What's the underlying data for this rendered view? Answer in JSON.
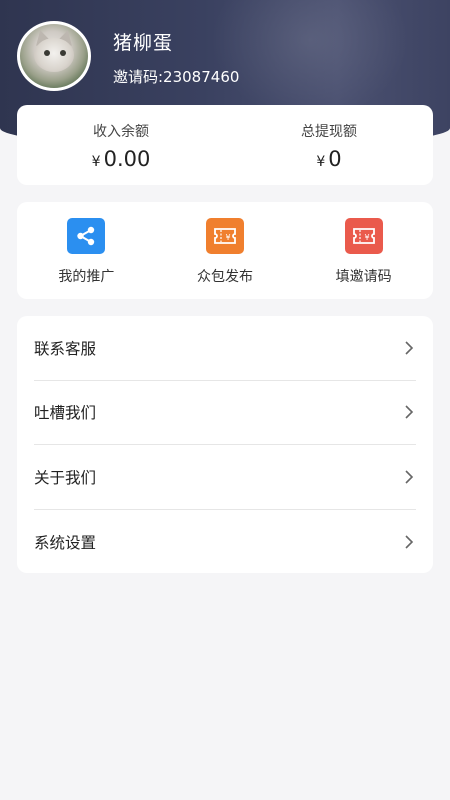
{
  "profile": {
    "username": "猪柳蛋",
    "invite_code": "邀请码:23087460"
  },
  "balance": {
    "income_label": "收入余额",
    "income_currency": "¥",
    "income_value": "0.00",
    "withdrawn_label": "总提现额",
    "withdrawn_currency": "¥",
    "withdrawn_value": "0"
  },
  "actions": [
    {
      "label": "我的推广",
      "icon": "share-icon",
      "color": "#2b8ff0"
    },
    {
      "label": "众包发布",
      "icon": "ticket-icon",
      "color": "#f07f2e"
    },
    {
      "label": "填邀请码",
      "icon": "ticket-icon",
      "color": "#ea5a4c"
    }
  ],
  "menu": [
    {
      "label": "联系客服",
      "icon": "chevron-right-icon"
    },
    {
      "label": "吐槽我们",
      "icon": "chevron-right-icon"
    },
    {
      "label": "关于我们",
      "icon": "chevron-right-icon"
    },
    {
      "label": "系统设置",
      "icon": "chevron-right-icon"
    }
  ],
  "colors": {
    "header": "#353b58",
    "background": "#f5f5f7",
    "card": "#ffffff"
  }
}
